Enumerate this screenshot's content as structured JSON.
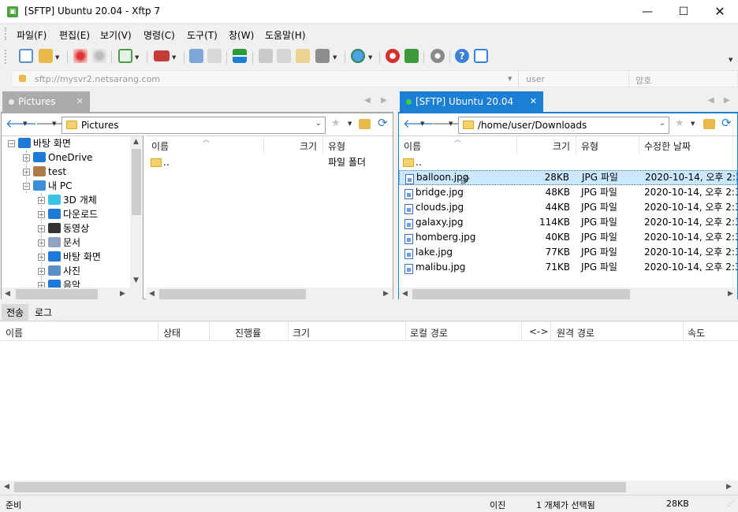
{
  "window": {
    "title": "[SFTP] Ubuntu 20.04 - Xftp 7"
  },
  "menu": [
    "파일(F)",
    "편집(E)",
    "보기(V)",
    "명령(C)",
    "도구(T)",
    "창(W)",
    "도움말(H)"
  ],
  "address": {
    "host": "sftp://mysvr2.netsarang.com",
    "user": "user",
    "password": "암호"
  },
  "left_tab": {
    "label": "Pictures"
  },
  "right_tab": {
    "label": "[SFTP] Ubuntu 20.04"
  },
  "left_path": "Pictures",
  "right_path": "/home/user/Downloads",
  "tree": [
    {
      "label": "바탕 화면",
      "icon": "desktop-icon",
      "color": "#1e7ad8"
    },
    {
      "label": "OneDrive",
      "icon": "cloud-icon",
      "color": "#1e7ad8"
    },
    {
      "label": "test",
      "icon": "user-icon",
      "color": "#b07a48"
    },
    {
      "label": "내 PC",
      "icon": "computer-icon",
      "color": "#3b8fd9"
    },
    {
      "label": "3D 개체",
      "icon": "cube-icon",
      "color": "#3cc2e6"
    },
    {
      "label": "다운로드",
      "icon": "download-icon",
      "color": "#1e7ad8"
    },
    {
      "label": "동영상",
      "icon": "film-icon",
      "color": "#333333"
    },
    {
      "label": "문서",
      "icon": "document-icon",
      "color": "#8fa4c0"
    },
    {
      "label": "바탕 화면",
      "icon": "desktop-icon",
      "color": "#1e7ad8"
    },
    {
      "label": "사진",
      "icon": "picture-icon",
      "color": "#5b8fc8"
    },
    {
      "label": "음악",
      "icon": "music-icon",
      "color": "#1e7ad8"
    }
  ],
  "left_columns": {
    "name": "이름",
    "size": "크기",
    "type": "유형"
  },
  "left_files": [
    {
      "name": "..",
      "type": "파일 폴더"
    }
  ],
  "right_columns": {
    "name": "이름",
    "size": "크기",
    "type": "유형",
    "modified": "수정한 날짜"
  },
  "right_files": [
    {
      "name": "balloon.jpg",
      "size": "28KB",
      "type": "JPG 파일",
      "modified": "2020-10-14, 오후 2:3"
    },
    {
      "name": "bridge.jpg",
      "size": "48KB",
      "type": "JPG 파일",
      "modified": "2020-10-14, 오후 2:3"
    },
    {
      "name": "clouds.jpg",
      "size": "44KB",
      "type": "JPG 파일",
      "modified": "2020-10-14, 오후 2:3"
    },
    {
      "name": "galaxy.jpg",
      "size": "114KB",
      "type": "JPG 파일",
      "modified": "2020-10-14, 오후 2:3"
    },
    {
      "name": "homberg.jpg",
      "size": "40KB",
      "type": "JPG 파일",
      "modified": "2020-10-14, 오후 2:3"
    },
    {
      "name": "lake.jpg",
      "size": "77KB",
      "type": "JPG 파일",
      "modified": "2020-10-14, 오후 2:3"
    },
    {
      "name": "malibu.jpg",
      "size": "71KB",
      "type": "JPG 파일",
      "modified": "2020-10-14, 오후 2:3"
    }
  ],
  "bottom_tabs": [
    "전송",
    "로그"
  ],
  "transfer_columns": [
    "이름",
    "상태",
    "진행률",
    "크기",
    "로컬 경로",
    "<->",
    "원격 경로",
    "속도"
  ],
  "status": {
    "ready": "준비",
    "mode": "이진",
    "selection": "1 개체가 선택됨",
    "size": "28KB"
  }
}
